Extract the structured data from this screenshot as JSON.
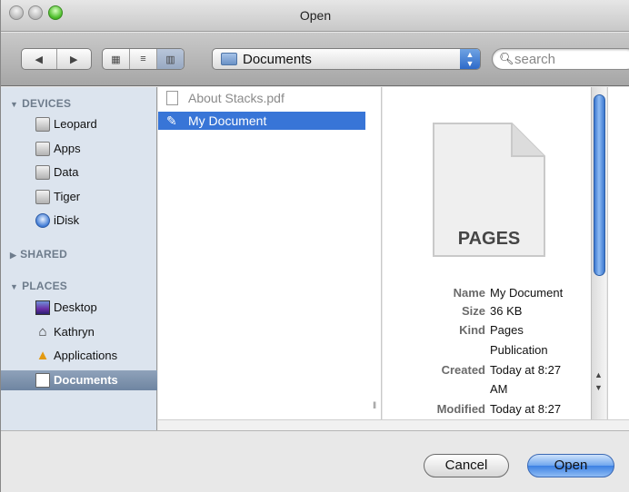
{
  "window": {
    "title": "Open"
  },
  "toolbar": {
    "nav": {
      "back_icon": "arrow-left-icon",
      "forward_icon": "arrow-right-icon"
    },
    "views": {
      "icon": "icon-view-icon",
      "list": "list-view-icon",
      "column": "column-view-icon",
      "active": "column"
    },
    "location": {
      "label": "Documents",
      "icon": "folder-icon"
    },
    "search": {
      "placeholder": "search",
      "icon": "magnifier-icon"
    }
  },
  "sidebar": {
    "devices": {
      "header": "DEVICES",
      "items": [
        "Leopard",
        "Apps",
        "Data",
        "Tiger",
        "iDisk"
      ]
    },
    "shared": {
      "header": "SHARED"
    },
    "places": {
      "header": "PLACES",
      "items": [
        "Desktop",
        "Kathryn",
        "Applications",
        "Documents"
      ],
      "selected": "Documents"
    }
  },
  "files": {
    "items": [
      {
        "name": "About Stacks.pdf",
        "icon": "pdf-file-icon",
        "enabled": false
      },
      {
        "name": "My Document",
        "icon": "pages-file-icon",
        "selected": true
      }
    ]
  },
  "preview": {
    "badge": "PAGES",
    "fields": [
      {
        "key": "Name",
        "value": "My Document"
      },
      {
        "key": "Size",
        "value": "36 KB"
      },
      {
        "key": "Kind",
        "value": "Pages"
      },
      {
        "key": "",
        "value": "Publication"
      },
      {
        "key": "Created",
        "value": "Today at 8:27"
      },
      {
        "key": "",
        "value": "AM"
      },
      {
        "key": "Modified",
        "value": "Today at 8:27"
      }
    ]
  },
  "buttons": {
    "cancel": "Cancel",
    "open": "Open"
  },
  "colors": {
    "selection": "#3875d7",
    "sidebar_bg": "#dce4ee",
    "default_button": "#4a8ae6"
  }
}
